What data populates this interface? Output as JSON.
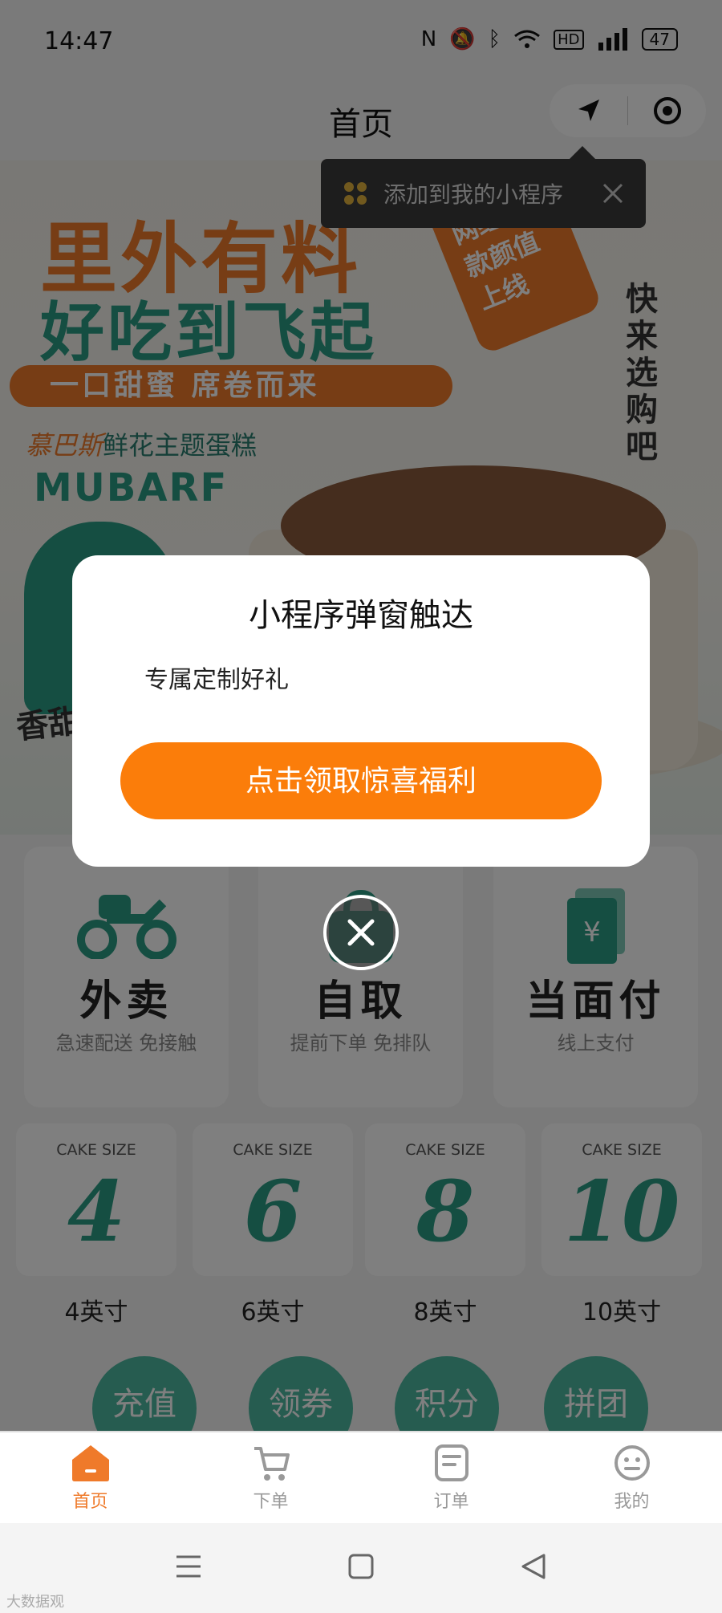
{
  "status_bar": {
    "time": "14:47",
    "battery": "47"
  },
  "nav": {
    "title": "首页"
  },
  "tooltip": {
    "text": "添加到我的小程序"
  },
  "banner": {
    "headline1": "里外有料",
    "headline2": "好吃到飞起",
    "slogan": "一口甜蜜  席卷而来",
    "brand": "慕巴斯",
    "theme": "鲜花主题蛋糕",
    "brand_en": "MUBARF",
    "hot_tag": "网红爆款颜值上线",
    "vertical_text": "快来选购吧",
    "side_text": "香甜"
  },
  "services": [
    {
      "title": "外卖",
      "subtitle": "急速配送 免接触",
      "icon": "scooter-icon"
    },
    {
      "title": "自取",
      "subtitle": "提前下单 免排队",
      "icon": "bag-icon"
    },
    {
      "title": "当面付",
      "subtitle": "线上支付",
      "icon": "yuan-card-icon"
    }
  ],
  "sizes": [
    {
      "caption": "CAKE SIZE",
      "number": "4",
      "label": "4英寸"
    },
    {
      "caption": "CAKE SIZE",
      "number": "6",
      "label": "6英寸"
    },
    {
      "caption": "CAKE SIZE",
      "number": "8",
      "label": "8英寸"
    },
    {
      "caption": "CAKE SIZE",
      "number": "10",
      "label": "10英寸"
    }
  ],
  "quick_actions": [
    "充值",
    "领券",
    "积分",
    "拼团"
  ],
  "tabs": [
    {
      "label": "首页",
      "icon": "home-icon",
      "active": true
    },
    {
      "label": "下单",
      "icon": "cart-icon",
      "active": false
    },
    {
      "label": "订单",
      "icon": "order-icon",
      "active": false
    },
    {
      "label": "我的",
      "icon": "profile-icon",
      "active": false
    }
  ],
  "modal": {
    "title": "小程序弹窗触达",
    "body": "专属定制好礼",
    "cta": "点击领取惊喜福利"
  },
  "watermark": "大数据观",
  "colors": {
    "accent": "#fb7d0a",
    "brand_green": "#2a9c84",
    "brand_orange": "#ef7a2a"
  }
}
